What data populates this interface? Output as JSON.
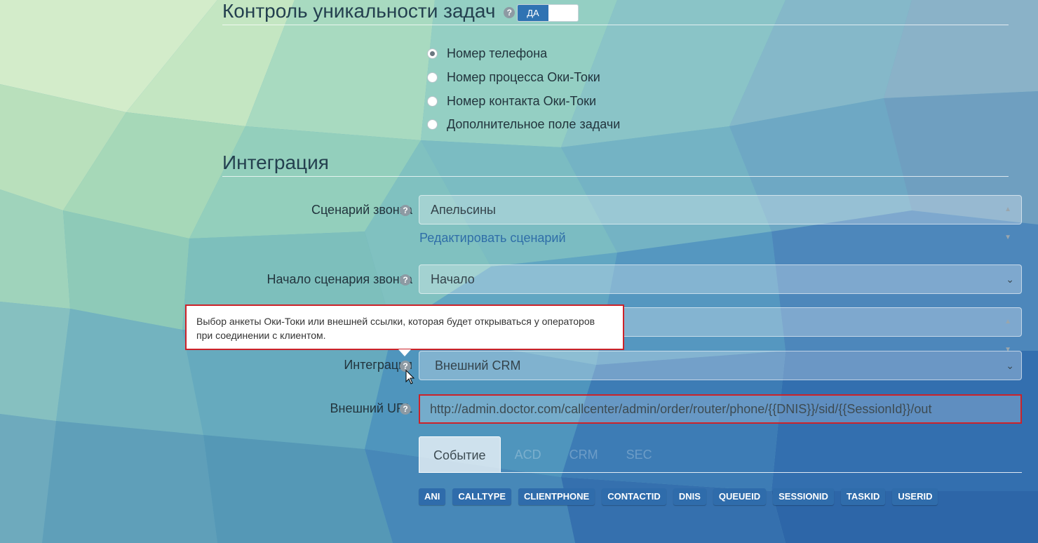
{
  "uniqueness": {
    "title": "Контроль уникальности задач",
    "toggle_label": "ДА",
    "options": [
      {
        "label": "Номер телефона",
        "checked": true
      },
      {
        "label": "Номер процесса Оки-Токи",
        "checked": false
      },
      {
        "label": "Номер контакта Оки-Токи",
        "checked": false
      },
      {
        "label": "Дополнительное поле задачи",
        "checked": false
      }
    ]
  },
  "integration": {
    "title": "Интеграция",
    "scenario_label": "Сценарий звонка",
    "scenario_value": "Апельсины",
    "edit_scenario_link": "Редактировать сценарий",
    "start_label": "Начало сценария звонка",
    "start_value": "Начало",
    "integration_label": "Интеграция",
    "integration_value": "Внешний CRM",
    "url_label": "Внешний URL",
    "url_value": "http://admin.doctor.com/callcenter/admin/order/router/phone/{{DNIS}}/sid/{{SessionId}}/out"
  },
  "tooltip": {
    "text": "Выбор анкеты Оки-Токи или внешней ссылки, которая будет открываться у операторов при соединении с клиентом."
  },
  "tabs": [
    {
      "label": "Событие",
      "active": true
    },
    {
      "label": "ACD",
      "active": false
    },
    {
      "label": "CRM",
      "active": false
    },
    {
      "label": "SEC",
      "active": false
    }
  ],
  "variables": [
    "ANI",
    "CALLTYPE",
    "CLIENTPHONE",
    "CONTACTID",
    "DNIS",
    "QUEUEID",
    "SESSIONID",
    "TASKID",
    "USERID"
  ],
  "help_icon_glyph": "?",
  "colors": {
    "primary": "#2f73b3",
    "variable_badge": "#2f6cab",
    "highlight_border": "#cc2229",
    "link": "#2f6ea8"
  }
}
